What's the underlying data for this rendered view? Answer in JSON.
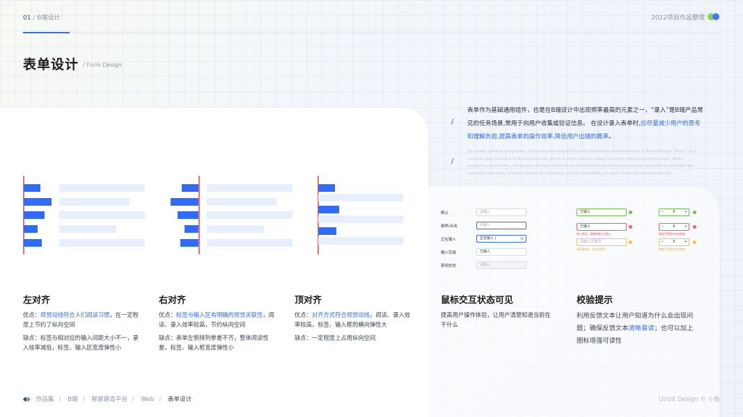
{
  "header": {
    "section_num": "01",
    "section_name": "B端设计",
    "project": "2022项目作品整理",
    "colors": {
      "accent": "#2f6bff",
      "dot_green": "#88d44a",
      "dot_blue": "#3a7bff"
    }
  },
  "page": {
    "title": "表单设计",
    "subtitle": "/ Form Design"
  },
  "intro": {
    "slash": "/",
    "cn_part1": "表单作为基础通用组件，也是在B端设计中出现频率最高的元素之一，“录入”是B端产品常见的任务场景,常用于向用户收集或验证信息。 在设计录入表单时,",
    "cn_highlight": "应尽量减少用户的思考和理解负担,提高表单的操作效率,降低用户出错的概率",
    "cn_end": "。",
    "en": "As a basic general component, forms are also one of the most frequently used elements in B-end design. \"Entry\" is a common task scenario of B-end products, which is often used to collect or verify information from users. When designing input forms, the burden of users' thinking and understanding should be reduced as much as possible, the operation efficiency of forms should be improved, and the probability of users' errors should be reduced."
  },
  "sections": [
    {
      "title": "左对齐",
      "pros_prefix": "优点：",
      "pros_highlight": "视觉动线符合人们阅读习惯",
      "pros_rest": "，在一定程度上节约了纵向空间",
      "cons": "缺点：标签与相对应的输入间距大小不一，录入效率减低，标签、输入区宽度弹性小"
    },
    {
      "title": "右对齐",
      "pros_prefix": "优点：",
      "pros_highlight": "标签与输入区有明确的视觉关联性",
      "pros_rest": "，阅读、录入效率较高，节约纵向空间",
      "cons": "缺点：表单左侧排列参差不齐，整体阅读性差，标签、输入框宽度弹性小"
    },
    {
      "title": "顶对齐",
      "pros_prefix": "优点：",
      "pros_highlight": "对齐方式符合视觉动线",
      "pros_rest": "，阅读、录入效率较高，标签、输入框的横向弹性大",
      "cons": "缺点：一定程度上占用纵向空间"
    },
    {
      "title": "鼠标交互状态可见",
      "text": "提高用户操作体验，让用户清楚知道当前在干什么"
    },
    {
      "title": "校验提示",
      "text_part1": "利用反馈文本让用户知道为什么会出现问题；确保反馈文本",
      "text_highlight": "清晰易读",
      "text_part2": "；也可以加上图标增强可读性"
    }
  ],
  "states_demo": {
    "rows": [
      {
        "label": "默认",
        "value": "请输入"
      },
      {
        "label": "悬停/点击",
        "value": "请输入"
      },
      {
        "label": "正在输入",
        "value": "正在输入 |"
      },
      {
        "label": "输入完成",
        "value": "已输入"
      },
      {
        "label": "禁用状态",
        "value": "请输入"
      }
    ],
    "clear_icon": "close-circle-icon"
  },
  "validate_demo": {
    "inputs": [
      {
        "value": "已输入",
        "status": "success",
        "color": "#6cc04a",
        "message": ""
      },
      {
        "value": "已输入",
        "status": "error",
        "color": "#ff5a5a",
        "message": "输入错误，请重新确认后输入"
      },
      {
        "value": "请输入关键词",
        "status": "warning",
        "color": "#f7c338",
        "message": "请注意格式，仅支持数字"
      }
    ],
    "steppers": [
      {
        "value": "6",
        "status": "success",
        "color": "#6cc04a",
        "message": ""
      },
      {
        "value": "6",
        "status": "error",
        "color": "#ff5a5a",
        "message": "数量不得超过库存数量"
      },
      {
        "value": "6",
        "status": "warning",
        "color": "#f7c338",
        "message": "数量不得超过库存数量"
      }
    ],
    "minus": "−",
    "plus": "+"
  },
  "footer": {
    "logo_icon": "diamond-logo-icon",
    "crumbs": [
      "作品集",
      "B端",
      "智慧建造平台",
      "Web",
      "表单设计"
    ],
    "separator": "/",
    "copyright": "UI/UX Design © 小鱼"
  }
}
